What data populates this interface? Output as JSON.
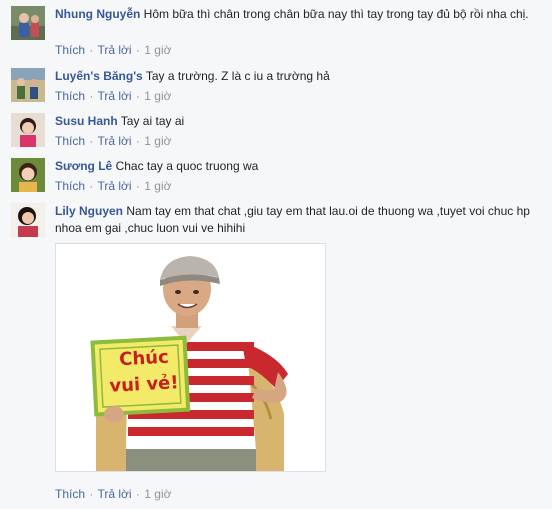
{
  "comments": [
    {
      "name": "Nhung Nguyễn",
      "text": "Hôm bữa thì chân trong chân bữa nay thì tay trong tay đủ bộ rồi nha chị.",
      "like": "Thích",
      "reply": "Trả lời",
      "time": "1 giờ"
    },
    {
      "name": "Luyến's Băng's",
      "text": "Tay a trường. Z là c iu a trường hả",
      "like": "Thích",
      "reply": "Trả lời",
      "time": "1 giờ"
    },
    {
      "name": "Susu Hanh",
      "text": "Tay ai tay ai",
      "like": "Thích",
      "reply": "Trả lời",
      "time": "1 giờ"
    },
    {
      "name": "Sương Lê",
      "text": "Chac tay a quoc truong wa",
      "like": "Thích",
      "reply": "Trả lời",
      "time": "1 giờ"
    },
    {
      "name": "Lily Nguyen",
      "text": "Nam tay em that chat ,giu tay em that lau.oi de thuong wa ,tuyet voi chuc hp nhoa em gai ,chuc luon vui ve hihihi",
      "like": "Thích",
      "reply": "Trả lời",
      "time": "1 giờ",
      "photo": {
        "sign_line1": "Chúc",
        "sign_line2": "vui vẻ!"
      }
    }
  ],
  "separator": "·",
  "colors": {
    "name_link": "#365899",
    "action_link": "#4b67a1",
    "meta": "#90949c",
    "background": "#f6f7f9"
  }
}
